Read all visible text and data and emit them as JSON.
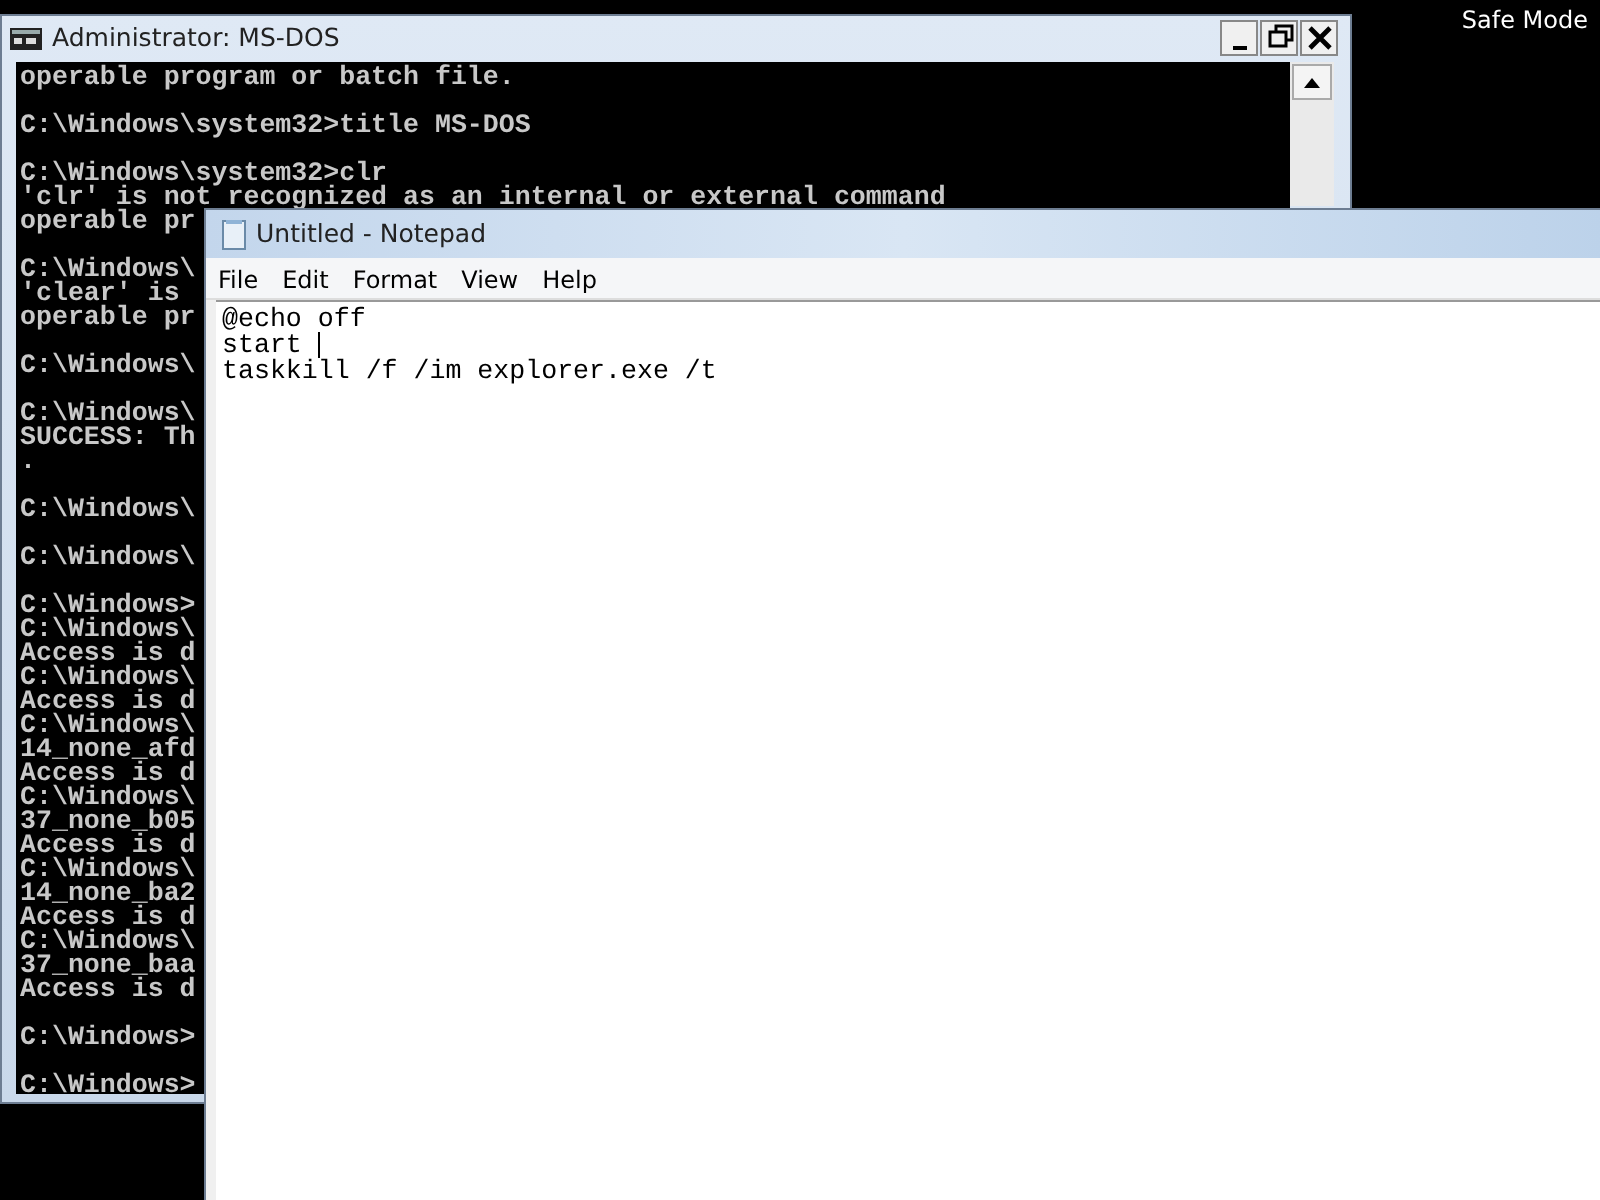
{
  "desktop": {
    "label": "Safe Mode"
  },
  "console_window": {
    "title": "Administrator:  MS-DOS",
    "blocks": [
      [
        "operable program or batch file."
      ],
      [
        "C:\\Windows\\system32>title MS-DOS"
      ],
      [
        "C:\\Windows\\system32>clr",
        "'clr' is not recognized as an internal or external command",
        "operable pr"
      ],
      [
        "C:\\Windows\\",
        "'clear' is ",
        "operable pr"
      ],
      [
        "C:\\Windows\\"
      ],
      [
        "C:\\Windows\\",
        "SUCCESS: Th",
        "."
      ],
      [
        "C:\\Windows\\"
      ],
      [
        "C:\\Windows\\"
      ],
      [
        "C:\\Windows>",
        "C:\\Windows\\",
        "Access is d",
        "C:\\Windows\\",
        "Access is d",
        "C:\\Windows\\",
        "14_none_afd",
        "Access is d",
        "C:\\Windows\\",
        "37_none_b05",
        "Access is d",
        "C:\\Windows\\",
        "14_none_ba2",
        "Access is d",
        "C:\\Windows\\",
        "37_none_baa",
        "Access is d"
      ],
      [
        "C:\\Windows>"
      ],
      [
        "C:\\Windows>"
      ]
    ]
  },
  "notepad_window": {
    "title": "Untitled - Notepad",
    "menu": [
      "File",
      "Edit",
      "Format",
      "View",
      "Help"
    ],
    "lines": [
      {
        "text": "@echo off",
        "caret": false
      },
      {
        "text": "start ",
        "caret": true
      },
      {
        "text": "taskkill /f /im explorer.exe /t",
        "caret": false
      }
    ]
  }
}
